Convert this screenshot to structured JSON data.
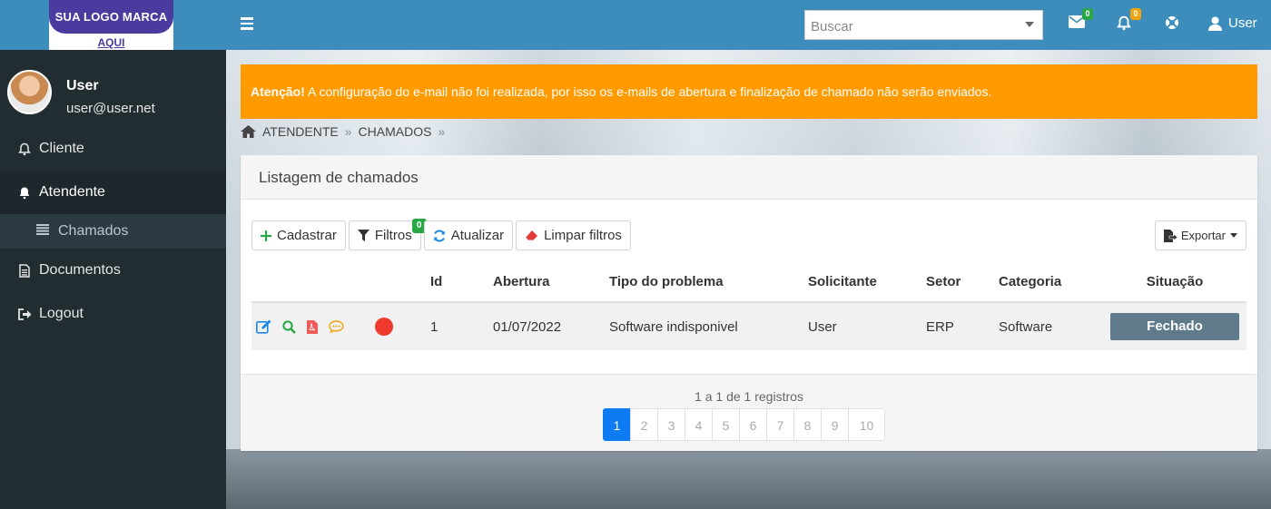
{
  "logo": {
    "main": "SUA LOGO MARCA",
    "sub": "AQUI"
  },
  "user": {
    "name": "User",
    "email": "user@user.net"
  },
  "sidebar": {
    "items": [
      {
        "label": "Cliente",
        "icon": "bell-outline-icon"
      },
      {
        "label": "Atendente",
        "icon": "bell-icon"
      },
      {
        "label": "Chamados",
        "icon": "list-icon"
      },
      {
        "label": "Documentos",
        "icon": "document-icon"
      },
      {
        "label": "Logout",
        "icon": "logout-icon"
      }
    ]
  },
  "topnav": {
    "search_placeholder": "Buscar",
    "mail_badge": "0",
    "bell_badge": "0",
    "user_label": "User"
  },
  "alert": {
    "strong": "Atenção!",
    "text": " A configuração do e-mail não foi realizada, por isso os e-mails de abertura e finalização de chamado não serão enviados."
  },
  "breadcrumb": [
    "ATENDENTE",
    "CHAMADOS"
  ],
  "panel": {
    "title": "Listagem de chamados",
    "toolbar": {
      "cadastrar": "Cadastrar",
      "filtros": "Filtros",
      "filtros_badge": "0",
      "atualizar": "Atualizar",
      "limpar": "Limpar filtros",
      "exportar": "Exportar"
    },
    "columns": [
      "Id",
      "Abertura",
      "Tipo do problema",
      "Solicitante",
      "Setor",
      "Categoria",
      "Situação"
    ],
    "rows": [
      {
        "id": "1",
        "abertura": "01/07/2022",
        "tipo": "Software indisponivel",
        "solicitante": "User",
        "setor": "ERP",
        "categoria": "Software",
        "situacao": "Fechado"
      }
    ],
    "records_text": "1 a 1 de 1 registros",
    "pages": [
      "1",
      "2",
      "3",
      "4",
      "5",
      "6",
      "7",
      "8",
      "9",
      "10"
    ],
    "current_page": "1"
  },
  "colors": {
    "topbar": "#3c8dbc",
    "sidebar": "#222d32",
    "alert": "#ff9a00",
    "status_dot": "#f03a2e",
    "situacao_badge": "#5f7a8a",
    "active_page": "#0d7cf2"
  }
}
